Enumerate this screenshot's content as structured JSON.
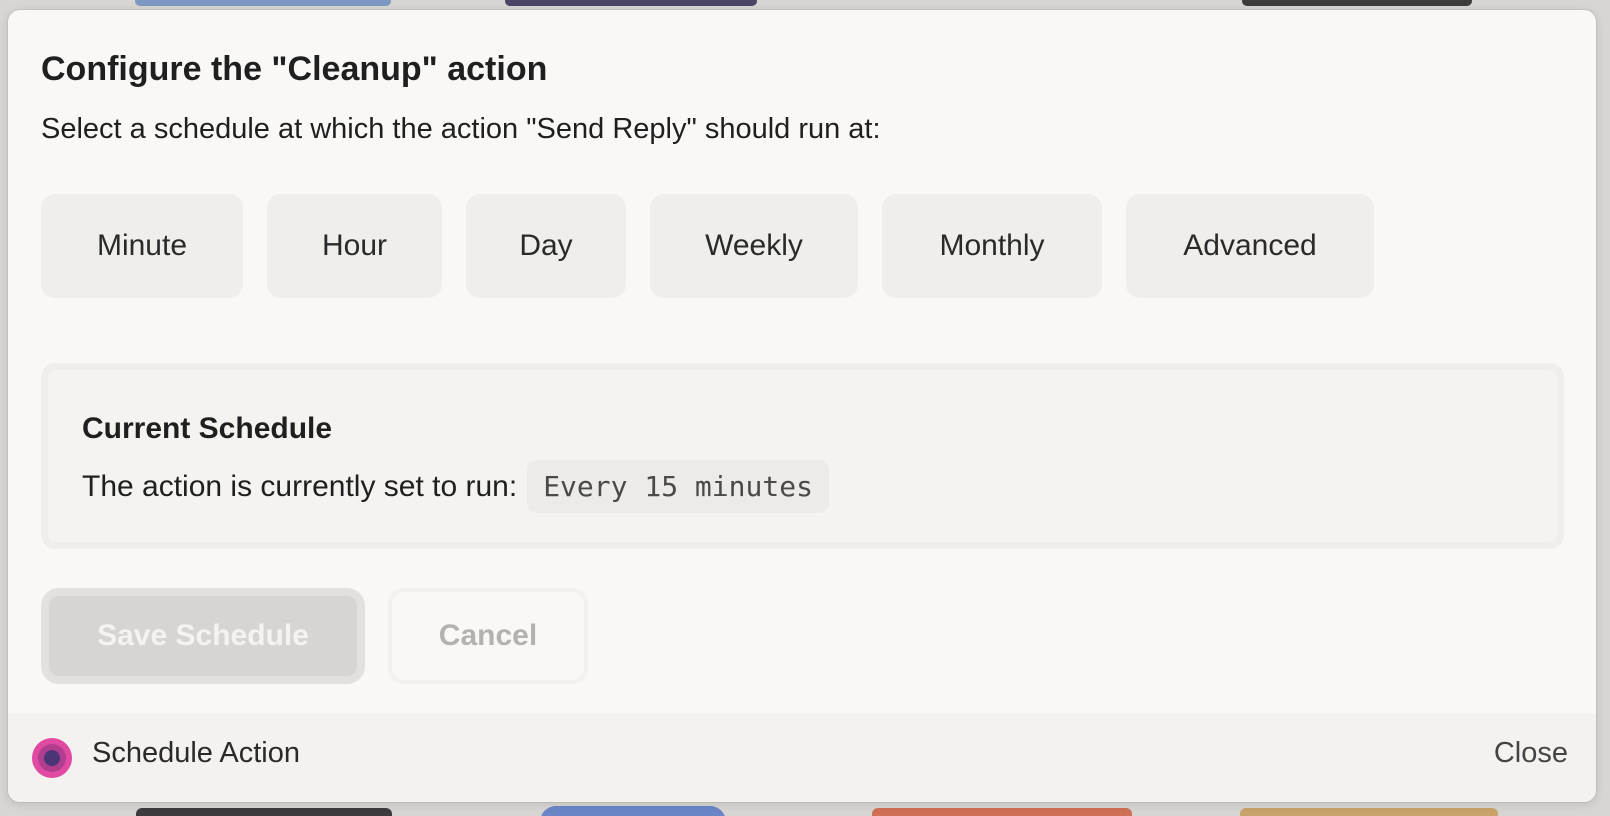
{
  "dialog": {
    "title": "Configure the \"Cleanup\" action",
    "subtitle": "Select a schedule at which the action \"Send Reply\" should run at:"
  },
  "schedule_options": [
    {
      "label": "Minute"
    },
    {
      "label": "Hour"
    },
    {
      "label": "Day"
    },
    {
      "label": "Weekly"
    },
    {
      "label": "Monthly"
    },
    {
      "label": "Advanced"
    }
  ],
  "current_schedule": {
    "heading": "Current Schedule",
    "description": "The action is currently set to run:",
    "value": "Every 15 minutes"
  },
  "actions": {
    "save_label": "Save Schedule",
    "cancel_label": "Cancel"
  },
  "footer": {
    "title": "Schedule Action",
    "close_label": "Close",
    "icon": "app-orb-icon"
  },
  "colors": {
    "icon_outer": "#e14aa2",
    "icon_inner": "#4a3577",
    "disabled_button": "#d6d5d2"
  }
}
